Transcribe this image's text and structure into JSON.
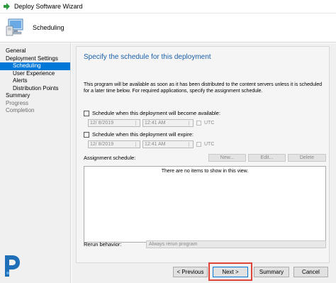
{
  "window": {
    "title": "Deploy Software Wizard"
  },
  "header": {
    "title": "Scheduling"
  },
  "nav": {
    "items": [
      {
        "label": "General",
        "state": "normal",
        "sub": false
      },
      {
        "label": "Deployment Settings",
        "state": "normal",
        "sub": false
      },
      {
        "label": "Scheduling",
        "state": "active",
        "sub": true
      },
      {
        "label": "User Experience",
        "state": "normal",
        "sub": true
      },
      {
        "label": "Alerts",
        "state": "normal",
        "sub": true
      },
      {
        "label": "Distribution Points",
        "state": "normal",
        "sub": true
      },
      {
        "label": "Summary",
        "state": "normal",
        "sub": false
      },
      {
        "label": "Progress",
        "state": "disabled",
        "sub": false
      },
      {
        "label": "Completion",
        "state": "disabled",
        "sub": false
      }
    ]
  },
  "main": {
    "heading": "Specify the schedule for this deployment",
    "description": "This program will be available as soon as it has been distributed to the content servers unless it is scheduled for a later time below. For required applications, specify the assignment schedule.",
    "available": {
      "label": "Schedule when this deployment will become available:",
      "date": "12/ 8/2019",
      "time": "12:41 AM",
      "utc": "UTC"
    },
    "expire": {
      "label": "Schedule when this deployment will expire:",
      "date": "12/ 8/2019",
      "time": "12:41 AM",
      "utc": "UTC"
    },
    "assignment": {
      "label": "Assignment schedule:",
      "new_label": "New...",
      "edit_label": "Edit...",
      "delete_label": "Delete",
      "empty_text": "There are no items to show in this view."
    },
    "rerun": {
      "label": "Rerun behavior:",
      "value": "Always rerun program"
    }
  },
  "footer": {
    "previous_label": "< Previous",
    "next_label": "Next >",
    "summary_label": "Summary",
    "cancel_label": "Cancel"
  },
  "colors": {
    "accent": "#0078d7",
    "heading": "#1a5fa8",
    "highlight": "#e0453a"
  }
}
